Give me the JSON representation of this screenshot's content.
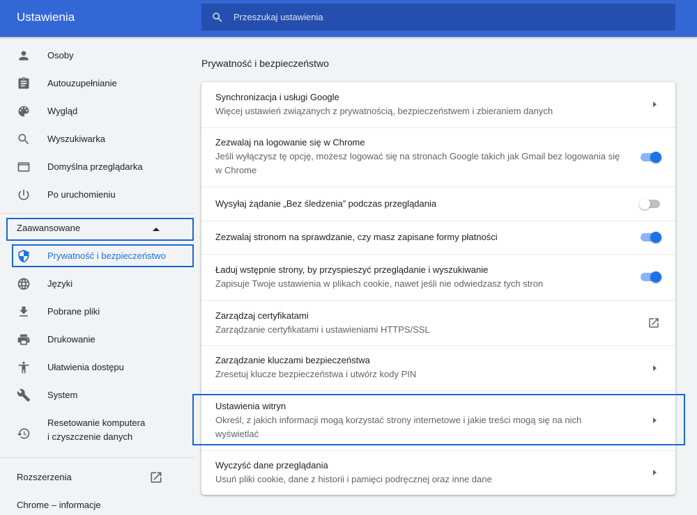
{
  "header": {
    "title": "Ustawienia",
    "search_placeholder": "Przeszukaj ustawienia"
  },
  "sidebar": {
    "items": [
      {
        "label": "Osoby",
        "icon": "person-icon"
      },
      {
        "label": "Autouzupełnianie",
        "icon": "clipboard-icon"
      },
      {
        "label": "Wygląd",
        "icon": "palette-icon"
      },
      {
        "label": "Wyszukiwarka",
        "icon": "search-icon"
      },
      {
        "label": "Domyślna przeglądarka",
        "icon": "browser-icon"
      },
      {
        "label": "Po uruchomieniu",
        "icon": "power-icon"
      }
    ],
    "advanced_label": "Zaawansowane",
    "advanced_items": [
      {
        "label": "Prywatność i bezpieczeństwo",
        "icon": "shield-icon",
        "active": true
      },
      {
        "label": "Języki",
        "icon": "globe-icon"
      },
      {
        "label": "Pobrane pliki",
        "icon": "download-icon"
      },
      {
        "label": "Drukowanie",
        "icon": "printer-icon"
      },
      {
        "label": "Ułatwienia dostępu",
        "icon": "accessibility-icon"
      },
      {
        "label": "System",
        "icon": "wrench-icon"
      },
      {
        "label_line1": "Resetowanie komputera",
        "label_line2": "i czyszczenie danych",
        "icon": "restore-icon"
      }
    ],
    "extensions_label": "Rozszerzenia",
    "about_label": "Chrome – informacje"
  },
  "main": {
    "section_title": "Prywatność i bezpieczeństwo",
    "rows": [
      {
        "title": "Synchronizacja i usługi Google",
        "subtitle": "Więcej ustawień związanych z prywatnością, bezpieczeństwem i zbieraniem danych",
        "control": "arrow"
      },
      {
        "title": "Zezwalaj na logowanie się w Chrome",
        "subtitle_line1": "Jeśli wyłączysz tę opcję, możesz logować się na stronach Google takich jak Gmail bez logowania się",
        "subtitle_line2": "w Chrome",
        "control": "toggle",
        "value": true
      },
      {
        "title": "Wysyłaj żądanie „Bez śledzenia” podczas przeglądania",
        "control": "toggle",
        "value": false
      },
      {
        "title": "Zezwalaj stronom na sprawdzanie, czy masz zapisane formy płatności",
        "control": "toggle",
        "value": true
      },
      {
        "title": "Ładuj wstępnie strony, by przyspieszyć przeglądanie i wyszukiwanie",
        "subtitle": "Zapisuje Twoje ustawienia w plikach cookie, nawet jeśli nie odwiedzasz tych stron",
        "control": "toggle",
        "value": true
      },
      {
        "title": "Zarządzaj certyfikatami",
        "subtitle": "Zarządzanie certyfikatami i ustawieniami HTTPS/SSL",
        "control": "external"
      },
      {
        "title": "Zarządzanie kluczami bezpieczeństwa",
        "subtitle": "Zresetuj klucze bezpieczeństwa i utwórz kody PIN",
        "control": "arrow"
      },
      {
        "title": "Ustawienia witryn",
        "subtitle_line1": "Określ, z jakich informacji mogą korzystać strony internetowe i jakie treści mogą się na nich",
        "subtitle_line2": "wyświetlać",
        "control": "arrow"
      },
      {
        "title": "Wyczyść dane przeglądania",
        "subtitle": "Usuń pliki cookie, dane z historii i pamięci podręcznej oraz inne dane",
        "control": "arrow"
      }
    ]
  },
  "colors": {
    "header": "#3367d6",
    "accent": "#1a73e8",
    "highlight_box": "#1a66d1"
  }
}
